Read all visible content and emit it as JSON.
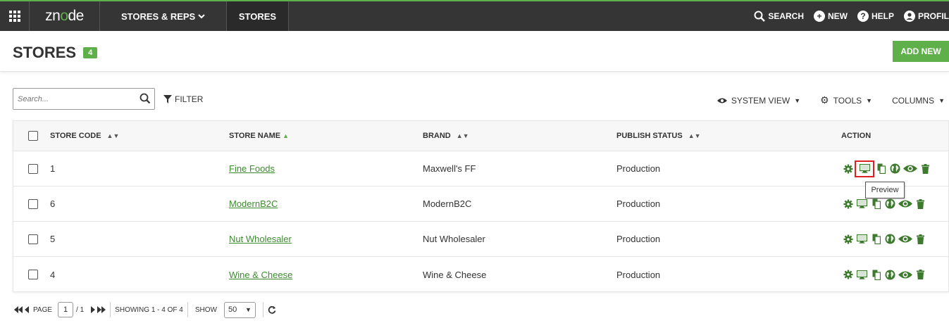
{
  "nav": {
    "logo_pre": "zn",
    "logo_o": "o",
    "logo_post": "de",
    "menu_stores_reps": "STORES & REPS",
    "menu_stores": "STORES",
    "search": "SEARCH",
    "new": "NEW",
    "help": "HELP",
    "profile": "PROFIL"
  },
  "header": {
    "title": "STORES",
    "count": "4",
    "add_new": "ADD NEW"
  },
  "toolbar": {
    "search_placeholder": "Search...",
    "filter": "FILTER",
    "system_view": "SYSTEM VIEW",
    "tools": "TOOLS",
    "columns": "COLUMNS"
  },
  "table": {
    "columns": [
      "STORE CODE",
      "STORE NAME",
      "BRAND",
      "PUBLISH STATUS",
      "ACTION"
    ],
    "rows": [
      {
        "code": "1",
        "name": "Fine Foods",
        "brand": "Maxwell's FF",
        "status": "Production"
      },
      {
        "code": "6",
        "name": "ModernB2C",
        "brand": "ModernB2C",
        "status": "Production"
      },
      {
        "code": "5",
        "name": "Nut Wholesaler",
        "brand": "Nut Wholesaler",
        "status": "Production"
      },
      {
        "code": "4",
        "name": "Wine & Cheese",
        "brand": "Wine & Cheese",
        "status": "Production"
      }
    ],
    "tooltip": "Preview"
  },
  "pager": {
    "page_label": "PAGE",
    "page": "1",
    "of": "/ 1",
    "showing": "SHOWING 1 - 4 OF 4",
    "show_label": "SHOW",
    "show_value": "50"
  },
  "colors": {
    "accent": "#5fb04a",
    "topbar": "#353535",
    "link": "#3d8b2f",
    "highlight": "#e02020"
  },
  "icons": [
    "apps-grid-icon",
    "search-icon",
    "plus-circle-icon",
    "help-icon",
    "user-icon",
    "eye-icon",
    "gear-icon",
    "caret-down-icon",
    "filter-icon",
    "sort-icon",
    "settings-icon",
    "monitor-icon",
    "copy-icon",
    "globe-icon",
    "view-icon",
    "trash-icon",
    "first-page-icon",
    "prev-page-icon",
    "next-page-icon",
    "last-page-icon",
    "refresh-icon"
  ]
}
